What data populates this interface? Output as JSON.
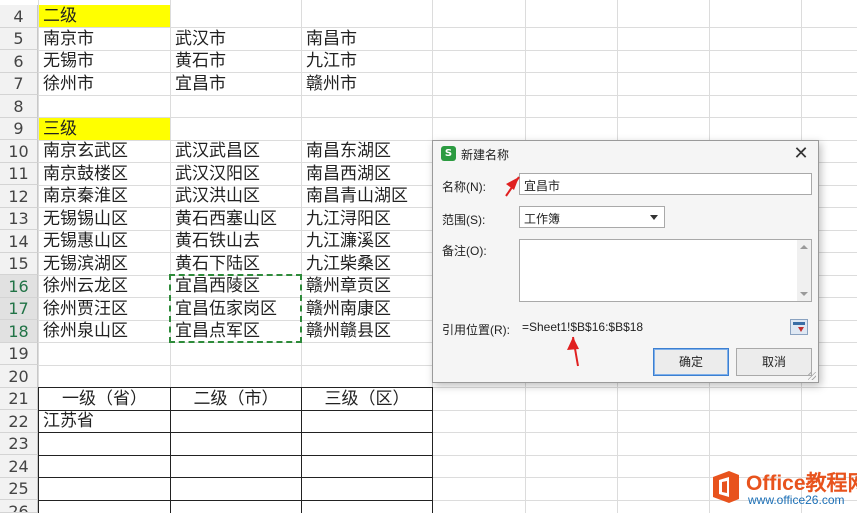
{
  "row_numbers": [
    "4",
    "5",
    "6",
    "7",
    "8",
    "9",
    "10",
    "11",
    "12",
    "13",
    "14",
    "15",
    "16",
    "17",
    "18",
    "19",
    "20",
    "21",
    "22",
    "23",
    "24",
    "25",
    "26"
  ],
  "cells": {
    "r4": {
      "a": "二级",
      "b": "",
      "c": ""
    },
    "r5": {
      "a": "南京市",
      "b": "武汉市",
      "c": "南昌市"
    },
    "r6": {
      "a": "无锡市",
      "b": "黄石市",
      "c": "九江市"
    },
    "r7": {
      "a": "徐州市",
      "b": "宜昌市",
      "c": "赣州市"
    },
    "r9": {
      "a": "三级",
      "b": "",
      "c": ""
    },
    "r10": {
      "a": "南京玄武区",
      "b": "武汉武昌区",
      "c": "南昌东湖区"
    },
    "r11": {
      "a": "南京鼓楼区",
      "b": "武汉汉阳区",
      "c": "南昌西湖区"
    },
    "r12": {
      "a": "南京秦淮区",
      "b": "武汉洪山区",
      "c": "南昌青山湖区"
    },
    "r13": {
      "a": "无锡锡山区",
      "b": "黄石西塞山区",
      "c": "九江浔阳区"
    },
    "r14": {
      "a": "无锡惠山区",
      "b": "黄石铁山去",
      "c": "九江濂溪区"
    },
    "r15": {
      "a": "无锡滨湖区",
      "b": "黄石下陆区",
      "c": "九江柴桑区"
    },
    "r16": {
      "a": "徐州云龙区",
      "b": "宜昌西陵区",
      "c": "赣州章贡区"
    },
    "r17": {
      "a": "徐州贾汪区",
      "b": "宜昌伍家岗区",
      "c": "赣州南康区"
    },
    "r18": {
      "a": "徐州泉山区",
      "b": "宜昌点军区",
      "c": "赣州赣县区"
    },
    "r21": {
      "a": "一级（省）",
      "b": "二级（市）",
      "c": "三级（区）"
    },
    "r22": {
      "a": "江苏省",
      "b": "",
      "c": ""
    }
  },
  "dialog": {
    "title": "新建名称",
    "close": "✕",
    "name_label": "名称(N):",
    "name_value": "宜昌市",
    "scope_label": "范围(S):",
    "scope_value": "工作簿",
    "comment_label": "备注(O):",
    "comment_value": "",
    "ref_label": "引用位置(R):",
    "ref_value": "=Sheet1!$B$16:$B$18",
    "ok": "确定",
    "cancel": "取消"
  },
  "watermark": {
    "brand": "Office教程网",
    "url": "www.office26.com"
  },
  "colors": {
    "highlight": "#ffff00",
    "marquee": "#2e8b3a",
    "arrow": "#e02020",
    "brand_orange": "#e8531d",
    "brand_blue": "#1b6fb6"
  }
}
